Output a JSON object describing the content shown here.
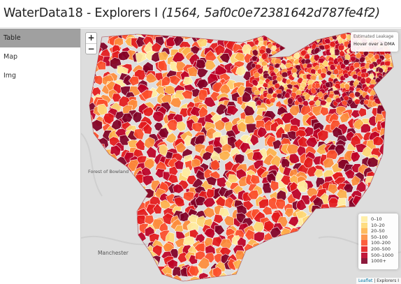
{
  "header": {
    "title": "WaterData18 - Explorers I",
    "subtitle": "(1564, 5af0c0e72381642d787fe4f2)"
  },
  "sidebar": {
    "items": [
      {
        "label": "Table",
        "active": true
      },
      {
        "label": "Map",
        "active": false
      },
      {
        "label": "Img",
        "active": false
      }
    ]
  },
  "map": {
    "zoom_in": "+",
    "zoom_out": "−",
    "info": {
      "heading": "Estimated Leakage",
      "hint": "Hover over a DMA"
    },
    "place_labels": {
      "forest": "Forest of Bowland",
      "city": "Manchester"
    },
    "legend": [
      {
        "label": "0–10",
        "color": "#ffeda0"
      },
      {
        "label": "10–20",
        "color": "#fed976"
      },
      {
        "label": "20–50",
        "color": "#feb24c"
      },
      {
        "label": "50–100",
        "color": "#fd8d3c"
      },
      {
        "label": "100–200",
        "color": "#fc4e2a"
      },
      {
        "label": "200–500",
        "color": "#e31a1c"
      },
      {
        "label": "500–1000",
        "color": "#bd0026"
      },
      {
        "label": "1000+",
        "color": "#800026"
      }
    ],
    "attribution": {
      "link": "Leaflet",
      "text": " | Explorers I"
    }
  }
}
